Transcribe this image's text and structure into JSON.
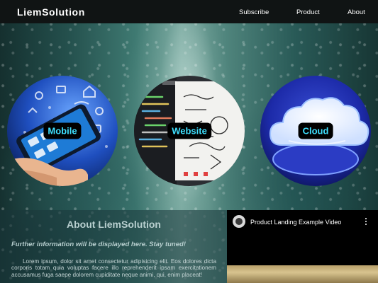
{
  "header": {
    "logo": "LiemSolution",
    "nav": {
      "subscribe": "Subscribe",
      "product": "Product",
      "about": "About"
    }
  },
  "services": {
    "mobile": {
      "label": "Mobile",
      "icon": "smartphone-icons-image"
    },
    "website": {
      "label": "Website",
      "icon": "code-and-whiteboard-image"
    },
    "cloud": {
      "label": "Cloud",
      "icon": "cloud-image"
    }
  },
  "about": {
    "title": "About LiemSolution",
    "subtitle": "Further information will be displayed here. Stay tuned!",
    "body": "Lorem ipsum, dolor sit amet consectetur adipisicing elit. Eos dolores dicta corporis totam quia voluptas facere illo reprehenderit ipsam exercitationem accusamus fuga saepe dolorem cupiditate neque animi, qui, enim placeat!"
  },
  "video": {
    "title": "Product Landing Example Video",
    "menu_icon": "more-vert-icon"
  },
  "colors": {
    "header_bg": "#101414",
    "label_bg": "#000000",
    "label_text": "#3fe0ff",
    "about_text": "#b8cfcf"
  }
}
